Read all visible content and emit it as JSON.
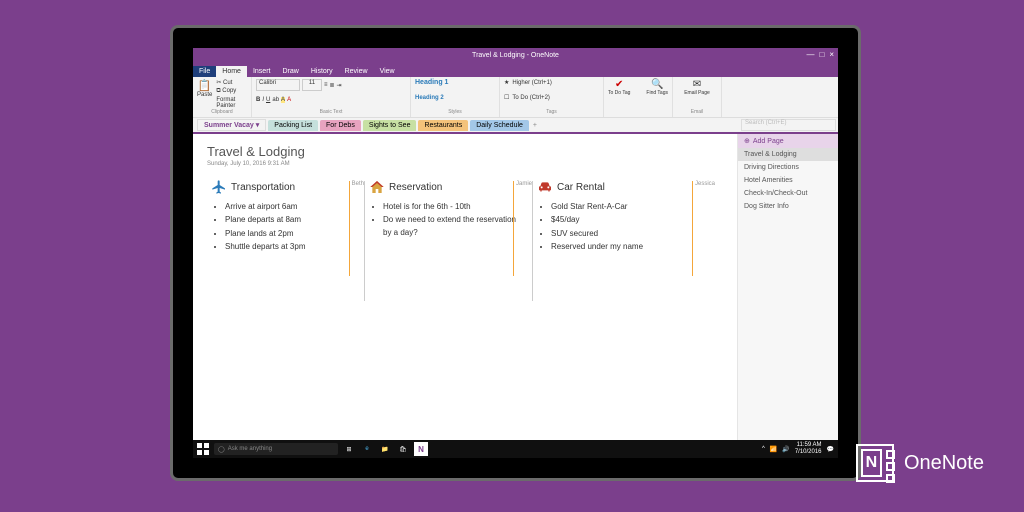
{
  "brand_label": "OneNote",
  "window_title": "Travel & Lodging - OneNote",
  "ribbon_tabs": {
    "file": "File",
    "home": "Home",
    "insert": "Insert",
    "draw": "Draw",
    "history": "History",
    "review": "Review",
    "view": "View"
  },
  "clipboard": {
    "paste": "Paste",
    "format_painter": "Format Painter",
    "label": "Clipboard"
  },
  "font": {
    "name": "Calibri",
    "size": "11",
    "label": "Basic Text"
  },
  "styles": {
    "h1": "Heading 1",
    "h2": "Heading 2",
    "label": "Styles"
  },
  "tags": {
    "item1": "Higher (Ctrl+1)",
    "item2": "To Do (Ctrl+2)",
    "todo": "To Do Tag",
    "find": "Find Tags",
    "label": "Tags"
  },
  "email": {
    "page": "Email Page",
    "label": "Email"
  },
  "notebook_selector": "Summer Vacay",
  "sections": {
    "packing": "Packing List",
    "fordebs": "For Debs",
    "sights": "Sights to See",
    "restaurants": "Restaurants",
    "daily": "Daily Schedule"
  },
  "search_placeholder": "Search (Ctrl+E)",
  "page_title": "Travel & Lodging",
  "page_date": "Sunday, July 10, 2016     9:31 AM",
  "columns": {
    "transport": {
      "heading": "Transportation",
      "author": "Beth",
      "items": [
        "Arrive at airport 6am",
        "Plane departs at 8am",
        "Plane lands at 2pm",
        "Shuttle departs at 3pm"
      ]
    },
    "reservation": {
      "heading": "Reservation",
      "author": "Jamie",
      "items": [
        "Hotel is for the 6th - 10th",
        "Do we need to extend the reservation by a day?"
      ]
    },
    "car": {
      "heading": "Car Rental",
      "author": "Jessica",
      "items": [
        "Gold Star Rent-A-Car",
        "$45/day",
        "SUV secured",
        "Reserved under my name"
      ]
    }
  },
  "pagelist": {
    "add": "Add Page",
    "p1": "Travel & Lodging",
    "p2": "Driving Directions",
    "p3": "Hotel Amenities",
    "p4": "Check-In/Check-Out",
    "p5": "Dog Sitter Info"
  },
  "cortana": "Ask me anything",
  "clock_time": "11:59 AM",
  "clock_date": "7/10/2016"
}
